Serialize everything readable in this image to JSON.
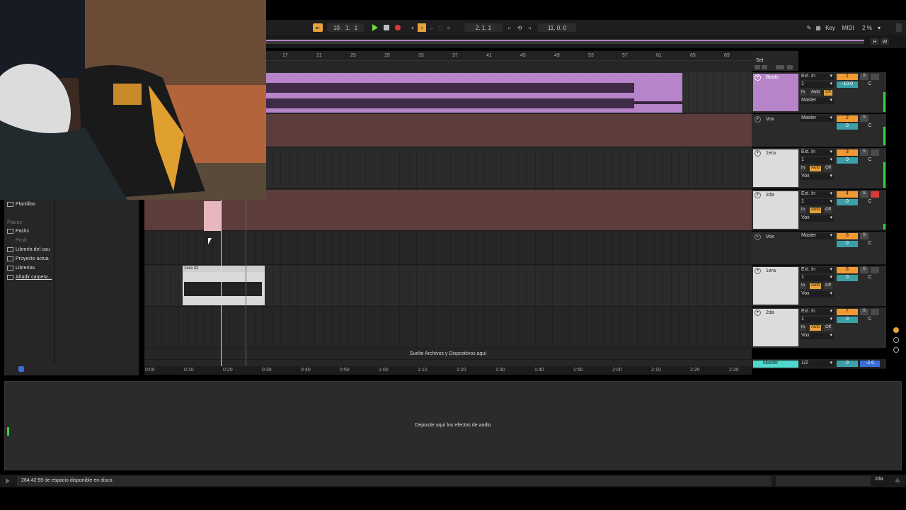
{
  "transport": {
    "position_bars": "10.",
    "position_beats": "1.",
    "position_sixteenths": "1",
    "loop_start": "2.  1.  1",
    "loop_length": "11.  0.  0",
    "key_label": "Key",
    "midi_label": "MIDI",
    "cpu": "2 %",
    "hw_h": "H",
    "hw_w": "W"
  },
  "ruler": {
    "ticks": [
      "17",
      "21",
      "25",
      "29",
      "33",
      "37",
      "41",
      "45",
      "49",
      "53",
      "57",
      "61",
      "65",
      "69"
    ],
    "set_label": "Set"
  },
  "time_ruler": {
    "ticks": [
      "0:00",
      "0:10",
      "0:20",
      "0:30",
      "0:40",
      "0:50",
      "1:00",
      "1:10",
      "1:20",
      "1:30",
      "1:40",
      "1:50",
      "2:00",
      "2:10",
      "2:20",
      "2:30"
    ]
  },
  "tracks": [
    {
      "name": "Beats",
      "input": "Ext. In",
      "channel": "1",
      "in": "In",
      "auto": "Auto",
      "off": "Off",
      "out": "Master",
      "num": "1",
      "vol": "-10.0",
      "pan": "C",
      "solo": "S"
    },
    {
      "name": "Vox",
      "input": "Master",
      "num": "2",
      "vol": "0",
      "pan": "C",
      "solo": "S"
    },
    {
      "name": "1era",
      "input": "Ext. In",
      "channel": "1",
      "in": "In",
      "auto": "Auto",
      "off": "Off",
      "out": "Vox",
      "num": "3",
      "vol": "0",
      "pan": "C",
      "solo": "S"
    },
    {
      "name": "2da",
      "input": "Ext. In",
      "channel": "1",
      "in": "In",
      "auto": "Auto",
      "off": "Off",
      "out": "Vox",
      "num": "4",
      "vol": "0",
      "pan": "C",
      "solo": "S"
    },
    {
      "name": "Vox",
      "input": "Master",
      "num": "5",
      "vol": "0",
      "pan": "C",
      "solo": "S"
    },
    {
      "name": "1era",
      "input": "Ext. In",
      "channel": "1",
      "in": "In",
      "auto": "Auto",
      "off": "Off",
      "out": "Vox",
      "num": "6",
      "vol": "0",
      "pan": "C",
      "solo": "S"
    },
    {
      "name": "2da",
      "input": "Ext. In",
      "channel": "1",
      "in": "In",
      "auto": "Auto",
      "off": "Off",
      "out": "Vox",
      "num": "7",
      "vol": "0",
      "pan": "C",
      "solo": "S"
    }
  ],
  "master": {
    "name": "Master",
    "input": "1/2",
    "vol": "0",
    "pan": "-2.0"
  },
  "clip": {
    "name": "1era 32"
  },
  "drop_hint": "Suelte Archivos y Dispositivos aquí",
  "browser": {
    "templates": "Plantillas",
    "places_header": "Places",
    "places": [
      "Packs",
      "Push",
      "Librería del usu",
      "Proyecto actua",
      "Librerías",
      "Añadir carpeta..."
    ]
  },
  "devices_hint": "Deposite aquí los efectos de audio",
  "status": {
    "message": "264:42:59 de espacio disponible en disco.",
    "selected_track": "2da"
  },
  "colors": {
    "beats_clip": "#b784c9",
    "vox_track": "#5c3d3b",
    "orange": "#f19a34",
    "teal": "#3ba0a8",
    "master": "#4fd8cc"
  }
}
